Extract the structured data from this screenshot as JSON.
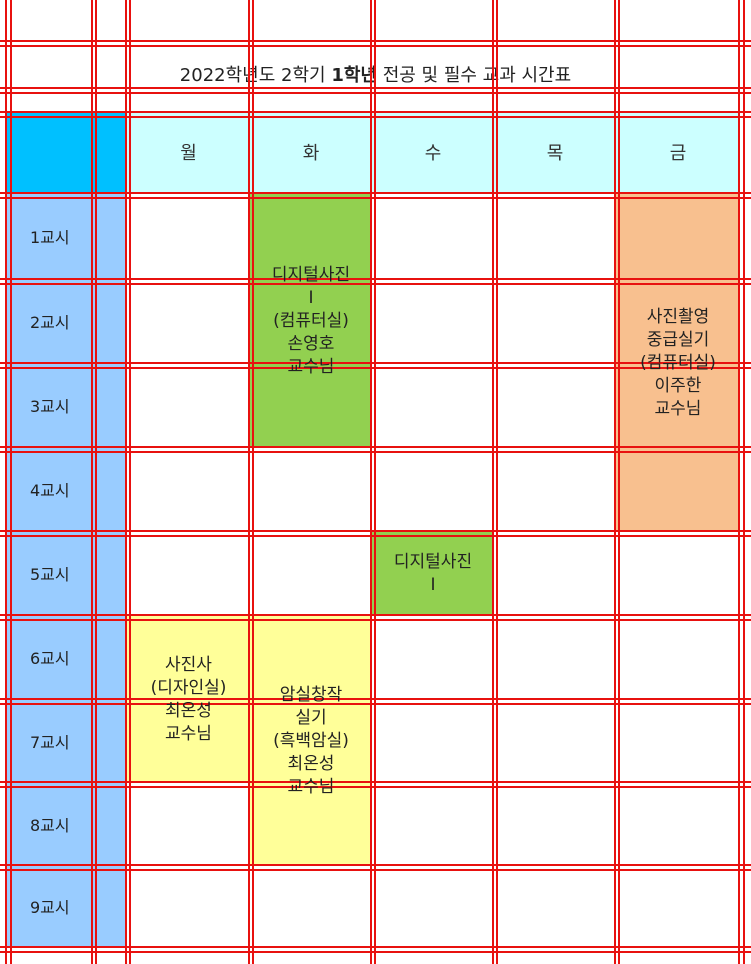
{
  "title": {
    "part1": "2022학년도 2학기 ",
    "part2": "1학년",
    "part3": " 전공 및 필수 교과 시간표"
  },
  "days": [
    "월",
    "화",
    "수",
    "목",
    "금"
  ],
  "periods": [
    "1교시",
    "2교시",
    "3교시",
    "4교시",
    "5교시",
    "6교시",
    "7교시",
    "8교시",
    "9교시"
  ],
  "courses": [
    {
      "day": 1,
      "from": 1,
      "to": 3,
      "color": "#92d050",
      "lines": [
        "디지털사진",
        "I",
        "(컴퓨터실)",
        "손영호",
        "교수님"
      ]
    },
    {
      "day": 4,
      "from": 1,
      "to": 4,
      "color": "#f8c08f",
      "lines": [
        "사진촬영",
        "중급실기",
        "(컴퓨터실)",
        "이주한",
        "교수님"
      ]
    },
    {
      "day": 2,
      "from": 5,
      "to": 5,
      "color": "#92d050",
      "lines": [
        "디지털사진",
        "I"
      ]
    },
    {
      "day": 0,
      "from": 6,
      "to": 7,
      "color": "#ffff99",
      "lines": [
        "사진사",
        "(디자인실)",
        "최온성",
        "교수님"
      ]
    },
    {
      "day": 1,
      "from": 6,
      "to": 8,
      "color": "#ffff99",
      "lines": [
        "암실창작",
        "실기",
        "(흑백암실)",
        "최온성",
        "교수님"
      ]
    }
  ],
  "colors": {
    "grid": "#e8110f",
    "corner_header": "#00c0ff",
    "day_header": "#ccffff",
    "period_column": "#99ccff"
  }
}
